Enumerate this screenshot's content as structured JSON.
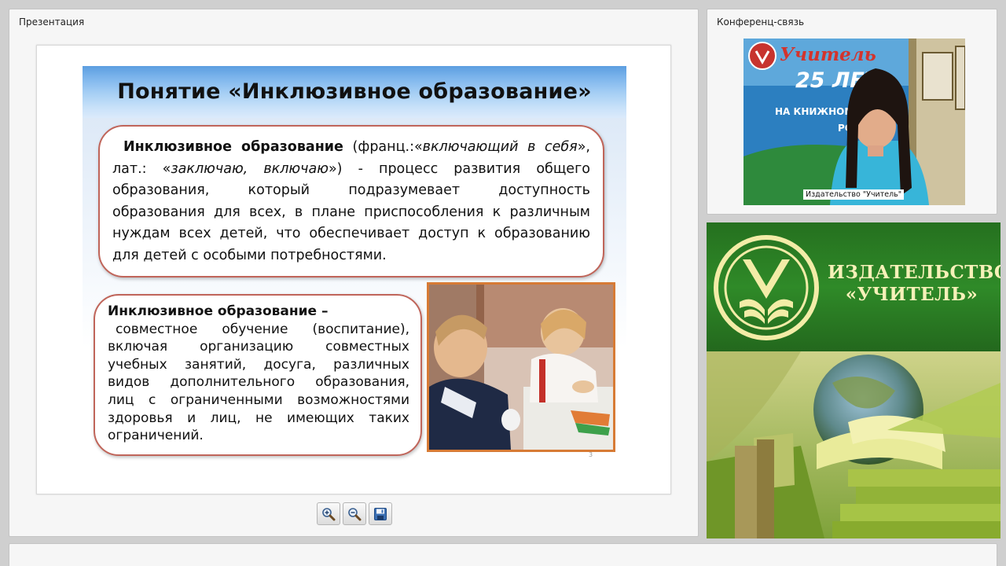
{
  "presentation_panel": {
    "title": "Презентация"
  },
  "conference_panel": {
    "title": "Конференц-связь"
  },
  "slide": {
    "title": "Понятие «Инклюзивное образование»",
    "box1": {
      "term": "Инклюзивное образование",
      "text1": " (франц.:«",
      "italic1": "включающий в себя",
      "text2": "»,",
      "text3": "лат.: «",
      "italic2": "заключаю, включаю",
      "text4": "») - процесс развития общего",
      "line3": "образования, который подразумевает доступность",
      "line4": "образования для всех, в плане приспособления к различным",
      "line5": "нуждам всех детей, что обеспечивает доступ к образованию",
      "line6": "для детей с особыми потребностями."
    },
    "box2": {
      "term": "Инклюзивное образование –",
      "line1": "совместное обучение (воспитание),",
      "line2": "включая организацию совместных",
      "line3": "учебных занятий, досуга, различных",
      "line4": "видов дополнительного образования,",
      "line5": "лиц с ограниченными возможностями",
      "line6": "здоровья и лиц, не имеющих таких",
      "line7": "ограничений."
    },
    "page_number": "3"
  },
  "toolbar": {
    "zoom_in": "zoom-in-icon",
    "zoom_out": "zoom-out-icon",
    "save": "save-icon"
  },
  "video": {
    "caption": "Издательство \"Учитель\"",
    "poster_title": "Учитель",
    "poster_years": "25 ЛЕТ",
    "poster_sub1": "НА КНИЖНОМ",
    "poster_sub2": "РО"
  },
  "banner": {
    "line1": "ИЗДАТЕЛЬСТВО",
    "line2": "«УЧИТЕЛЬ»"
  }
}
